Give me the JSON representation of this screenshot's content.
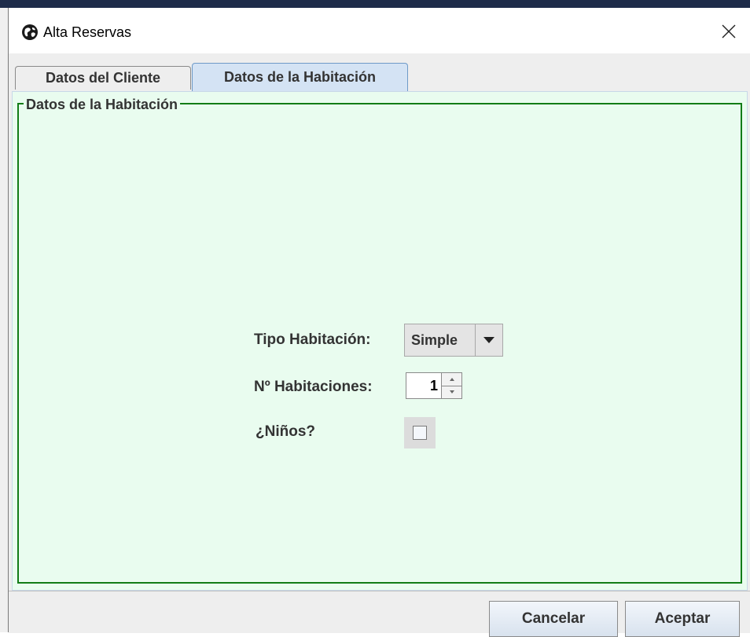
{
  "window": {
    "title": "Alta Reservas",
    "icon": "globe-icon",
    "close_icon": "close-icon"
  },
  "tabs": [
    {
      "label": "Datos del Cliente",
      "selected": false
    },
    {
      "label": "Datos de la Habitación",
      "selected": true
    }
  ],
  "panel": {
    "legend": "Datos de la Habitación",
    "tipo_label": "Tipo Habitación:",
    "tipo_value": "Simple",
    "num_label": "Nº Habitaciones:",
    "num_value": "1",
    "ninos_label": "¿Niños?",
    "ninos_checked": false
  },
  "buttons": {
    "cancel": "Cancelar",
    "accept": "Aceptar"
  },
  "colors": {
    "panel_bg": "#e9fcef",
    "fieldset_border": "#127c16",
    "selected_tab_bg": "#d4e3f4"
  }
}
